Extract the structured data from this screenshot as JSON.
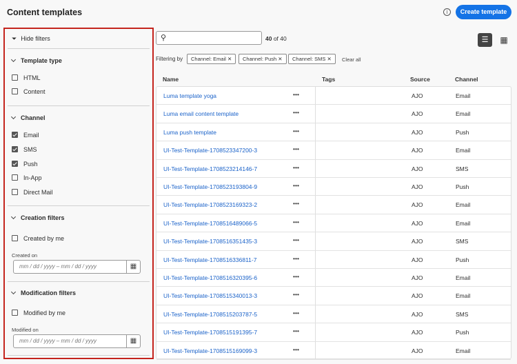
{
  "header": {
    "title": "Content templates",
    "create_label": "Create template"
  },
  "sidebar": {
    "hide_filters": "Hide filters",
    "template_type": {
      "title": "Template type",
      "items": [
        {
          "label": "HTML",
          "checked": false
        },
        {
          "label": "Content",
          "checked": false
        }
      ]
    },
    "channel": {
      "title": "Channel",
      "items": [
        {
          "label": "Email",
          "checked": true
        },
        {
          "label": "SMS",
          "checked": true
        },
        {
          "label": "Push",
          "checked": true
        },
        {
          "label": "In-App",
          "checked": false
        },
        {
          "label": "Direct Mail",
          "checked": false
        }
      ]
    },
    "creation": {
      "title": "Creation filters",
      "by_me": "Created by me",
      "date_label": "Created on",
      "date_placeholder": "mm / dd / yyyy  –  mm / dd / yyyy"
    },
    "modification": {
      "title": "Modification filters",
      "by_me": "Modified by me",
      "date_label": "Modified on",
      "date_placeholder": "mm / dd / yyyy  –  mm / dd / yyyy"
    }
  },
  "toolbar": {
    "count_bold": "40",
    "count_rest": " of 40",
    "filtering_by": "Filtering by",
    "chips": [
      "Channel: Email",
      "Channel: Push",
      "Channel: SMS"
    ],
    "clear_all": "Clear all"
  },
  "table": {
    "headers": [
      "Name",
      "Tags",
      "Source",
      "Channel"
    ],
    "rows": [
      {
        "name": "Luma template yoga",
        "source": "AJO",
        "channel": "Email"
      },
      {
        "name": "Luma email content template",
        "source": "AJO",
        "channel": "Email"
      },
      {
        "name": "Luma push template",
        "source": "AJO",
        "channel": "Push"
      },
      {
        "name": "UI-Test-Template-1708523347200-3",
        "source": "AJO",
        "channel": "Email"
      },
      {
        "name": "UI-Test-Template-1708523214146-7",
        "source": "AJO",
        "channel": "SMS"
      },
      {
        "name": "UI-Test-Template-1708523193804-9",
        "source": "AJO",
        "channel": "Push"
      },
      {
        "name": "UI-Test-Template-1708523169323-2",
        "source": "AJO",
        "channel": "Email"
      },
      {
        "name": "UI-Test-Template-1708516489066-5",
        "source": "AJO",
        "channel": "Email"
      },
      {
        "name": "UI-Test-Template-1708516351435-3",
        "source": "AJO",
        "channel": "SMS"
      },
      {
        "name": "UI-Test-Template-1708516336811-7",
        "source": "AJO",
        "channel": "Push"
      },
      {
        "name": "UI-Test-Template-1708516320395-6",
        "source": "AJO",
        "channel": "Email"
      },
      {
        "name": "UI-Test-Template-1708515340013-3",
        "source": "AJO",
        "channel": "Email"
      },
      {
        "name": "UI-Test-Template-1708515203787-5",
        "source": "AJO",
        "channel": "SMS"
      },
      {
        "name": "UI-Test-Template-1708515191395-7",
        "source": "AJO",
        "channel": "Push"
      },
      {
        "name": "UI-Test-Template-1708515169099-3",
        "source": "AJO",
        "channel": "Email"
      }
    ]
  },
  "colors": {
    "accent": "#1473e6",
    "link": "#1a62c9",
    "highlight_border": "#c4231c"
  }
}
